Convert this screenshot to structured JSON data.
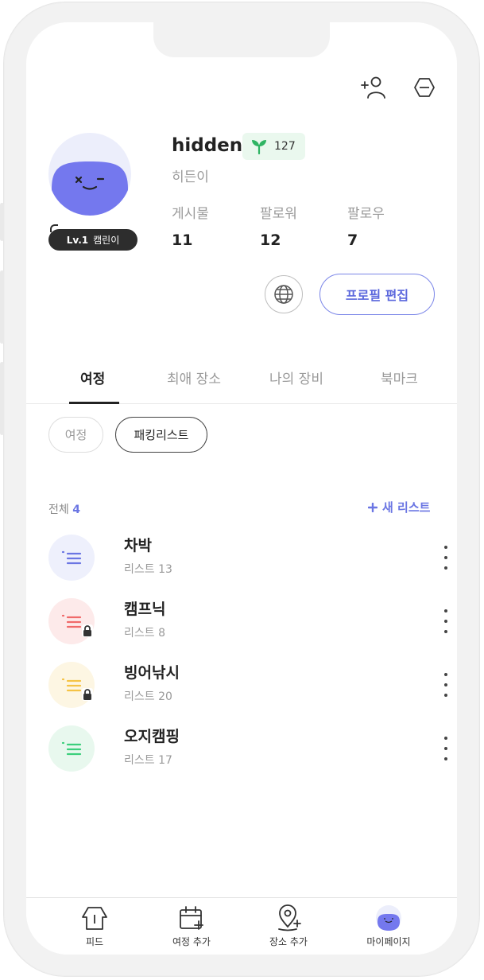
{
  "header": {
    "add_friend_icon": "add-person-icon",
    "menu_icon": "hexagon-minus-icon"
  },
  "profile": {
    "username": "hidden",
    "points": "127",
    "nickname": "히든이",
    "level": {
      "lv": "Lv.1",
      "title": "캠린이"
    },
    "stats": [
      {
        "label": "게시물",
        "value": "11"
      },
      {
        "label": "팔로워",
        "value": "12"
      },
      {
        "label": "팔로우",
        "value": "7"
      }
    ],
    "edit_label": "프로필 편집"
  },
  "tabs": [
    {
      "label": "여정",
      "active": true
    },
    {
      "label": "최애 장소",
      "active": false
    },
    {
      "label": "나의 장비",
      "active": false
    },
    {
      "label": "북마크",
      "active": false
    }
  ],
  "chips": [
    {
      "label": "여정",
      "selected": false
    },
    {
      "label": "패킹리스트",
      "selected": true
    }
  ],
  "list_header": {
    "total_label": "전체",
    "total_count": "4",
    "new_list_label": "새 리스트"
  },
  "lists": [
    {
      "title": "차박",
      "subtitle": "리스트 13",
      "color": "#6b76e3",
      "bg": "#eef0fc",
      "locked": false
    },
    {
      "title": "캠프닉",
      "subtitle": "리스트 8",
      "color": "#f06a6a",
      "bg": "#fdeaea",
      "locked": true
    },
    {
      "title": "빙어낚시",
      "subtitle": "리스트 20",
      "color": "#f5c345",
      "bg": "#fdf6e3",
      "locked": true
    },
    {
      "title": "오지캠핑",
      "subtitle": "리스트 17",
      "color": "#3ccf7c",
      "bg": "#e8f8ee",
      "locked": false
    }
  ],
  "bottom_nav": [
    {
      "label": "피드"
    },
    {
      "label": "여정 추가"
    },
    {
      "label": "장소 추가"
    },
    {
      "label": "마이페이지"
    }
  ],
  "colors": {
    "accent": "#6b76e3",
    "avatar": "#7478ee"
  }
}
